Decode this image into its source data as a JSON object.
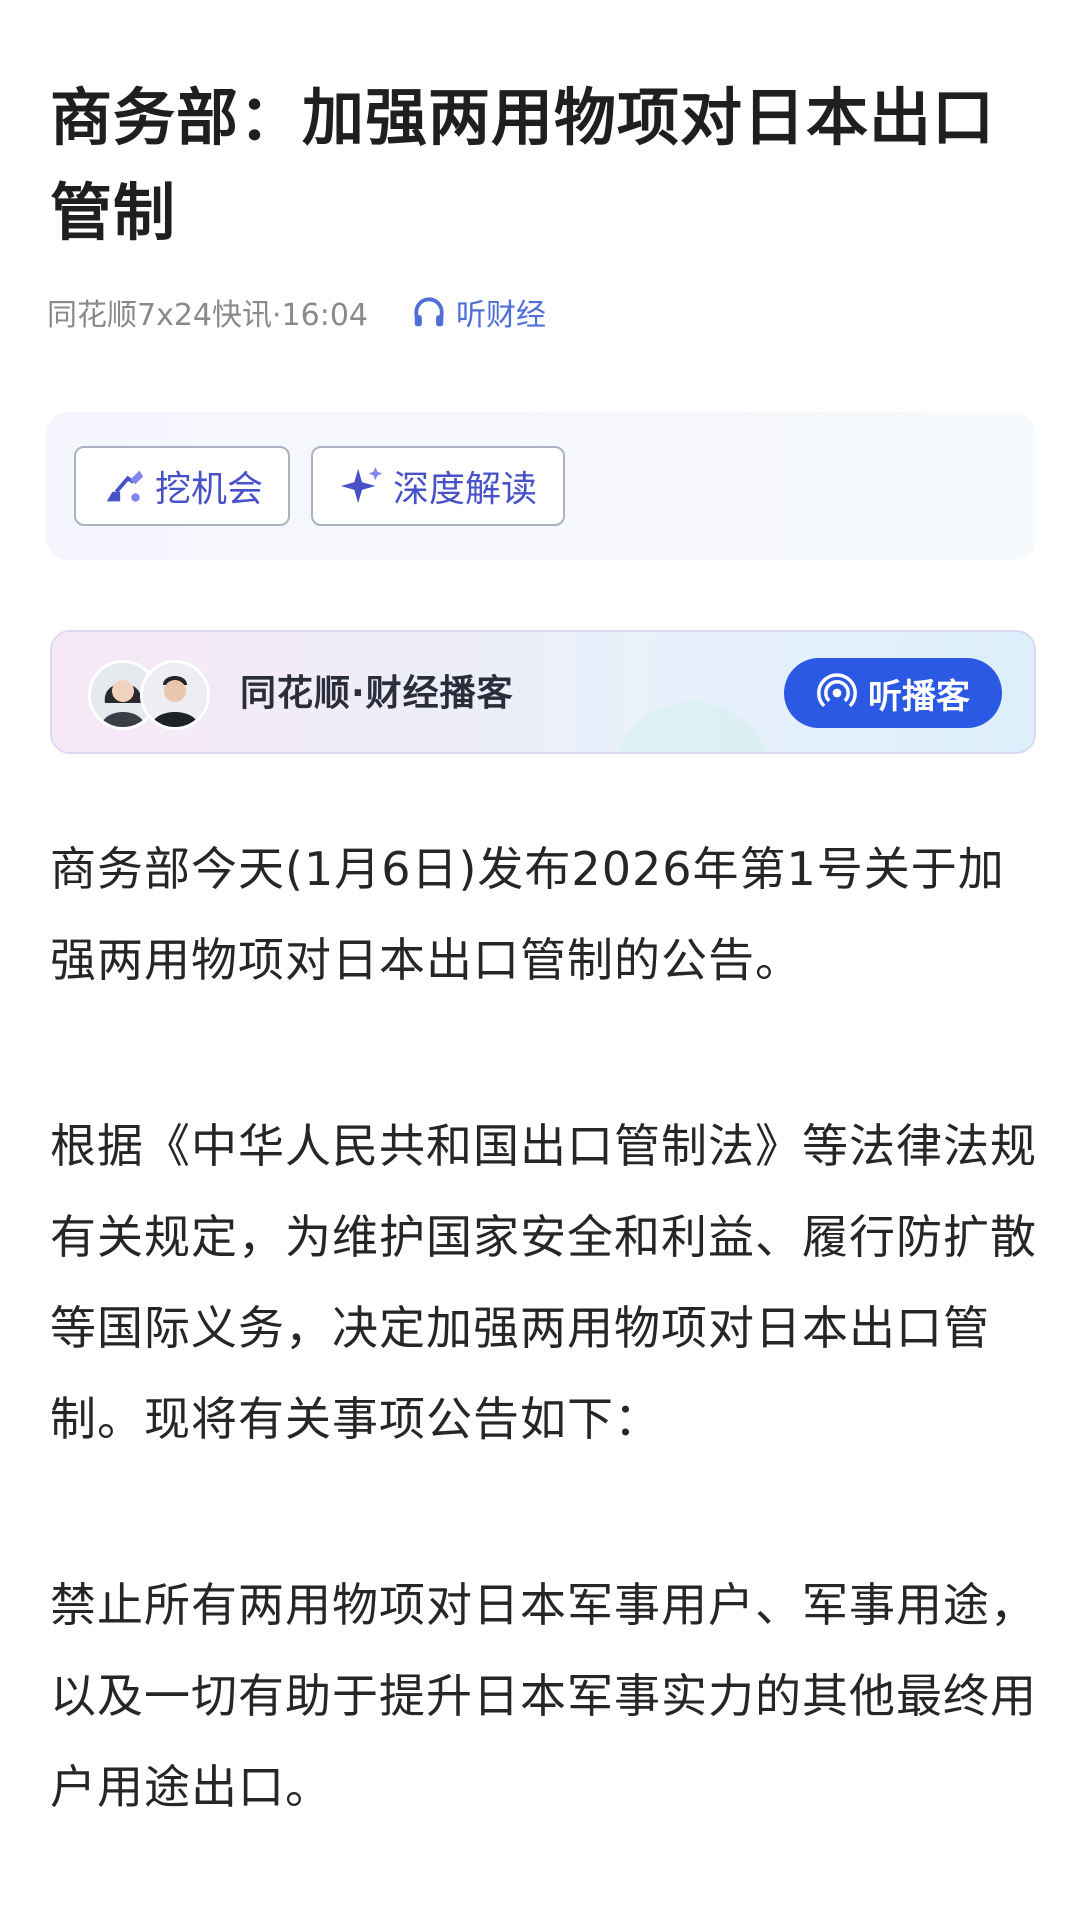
{
  "article": {
    "title": "商务部：加强两用物项对日本出口管制",
    "source_time": "同花顺7x24快讯·16:04",
    "listen_label": "听财经"
  },
  "actions": {
    "opportunity_label": "挖机会",
    "deep_read_label": "深度解读"
  },
  "podcast": {
    "title": "同花顺·财经播客",
    "button_label": "听播客"
  },
  "body": {
    "paragraphs": [
      "商务部今天(1月6日)发布2026年第1号关于加强两用物项对日本出口管制的公告。",
      "根据《中华人民共和国出口管制法》等法律法规有关规定，为维护国家安全和利益、履行防扩散等国际义务，决定加强两用物项对日本出口管制。现将有关事项公告如下：",
      "禁止所有两用物项对日本军事用户、军事用途，以及一切有助于提升日本军事实力的其他最终用户用途出口。"
    ]
  },
  "colors": {
    "accent_blue": "#2c59e3",
    "chip_text": "#4852c8",
    "meta_gray": "#8a8a8a"
  },
  "icons": {
    "listen": "headphones-icon",
    "opportunity": "excavator-icon",
    "deep_read": "sparkle-icon",
    "podcast": "broadcast-icon"
  }
}
